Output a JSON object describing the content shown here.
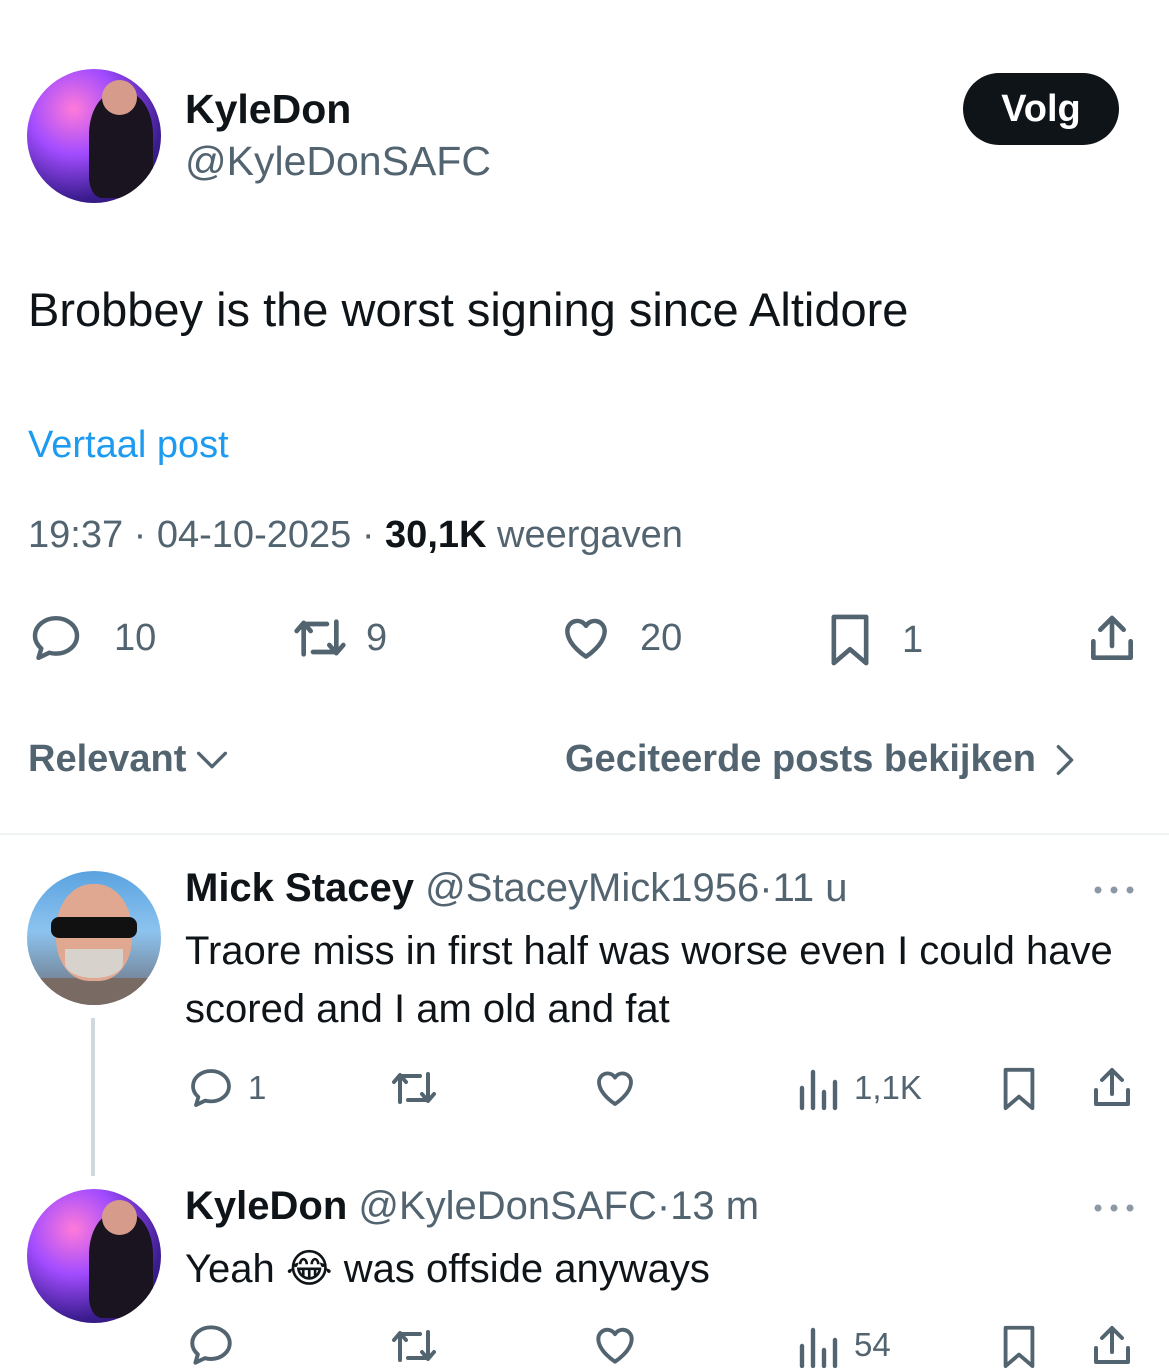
{
  "post": {
    "author_name": "KyleDon",
    "author_handle": "@KyleDonSAFC",
    "follow_label": "Volg",
    "text": "Brobbey is the worst signing since Altidore",
    "translate_label": "Vertaal post",
    "time": "19:37",
    "date": "04-10-2025",
    "views_count": "30,1K",
    "views_label": "weergaven",
    "sep": "·",
    "actions": {
      "replies": "10",
      "reposts": "9",
      "likes": "20",
      "bookmarks": "1"
    }
  },
  "sort": {
    "label": "Relevant",
    "quotes_label": "Geciteerde posts bekijken"
  },
  "replies": [
    {
      "name": "Mick Stacey",
      "handle": "@StaceyMick1956",
      "sep": "·",
      "time": "11 u",
      "text": "Traore miss in first half was worse even I could have scored and I am old and fat",
      "reply_count": "1",
      "views": "1,1K"
    },
    {
      "name": "KyleDon",
      "handle": "@KyleDonSAFC",
      "sep": "·",
      "time": "13 m",
      "text_before": "Yeah",
      "emoji": "😂",
      "text_after": "was offside anyways",
      "views": "54"
    }
  ],
  "icons": {
    "reply": "reply-icon",
    "repost": "repost-icon",
    "like": "heart-icon",
    "bookmark": "bookmark-icon",
    "share": "share-icon",
    "views": "views-icon",
    "more": "more-icon"
  },
  "colors": {
    "text": "#0f1419",
    "secondary": "#536471",
    "link": "#1d9bf0",
    "divider": "#eff3f4"
  }
}
